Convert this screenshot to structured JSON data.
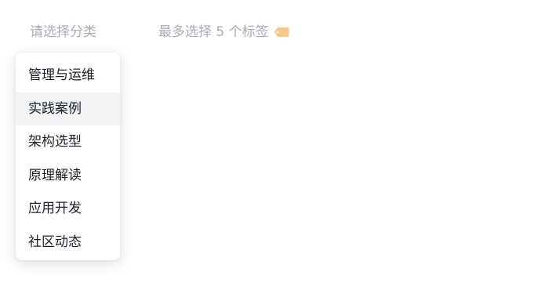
{
  "category_select": {
    "placeholder": "请选择分类"
  },
  "tags_input": {
    "placeholder": "最多选择 5 个标签",
    "icon": "tag-icon",
    "icon_color": "#f5c98a"
  },
  "dropdown": {
    "items": [
      {
        "label": "管理与运维",
        "highlighted": false
      },
      {
        "label": "实践案例",
        "highlighted": true
      },
      {
        "label": "架构选型",
        "highlighted": false
      },
      {
        "label": "原理解读",
        "highlighted": false
      },
      {
        "label": "应用开发",
        "highlighted": false
      },
      {
        "label": "社区动态",
        "highlighted": false
      }
    ],
    "highlight_color": "#f2f3f5"
  }
}
